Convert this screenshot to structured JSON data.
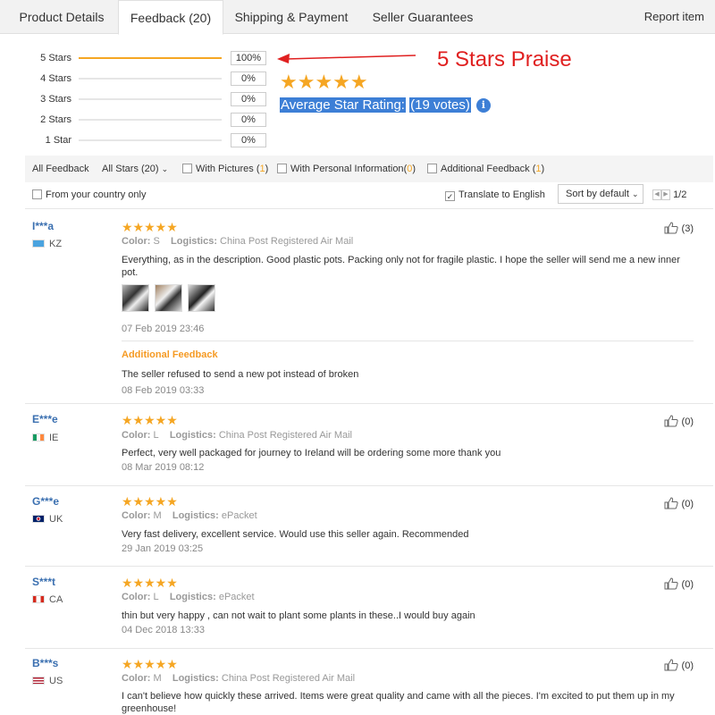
{
  "tabs": [
    {
      "label": "Product Details"
    },
    {
      "label": "Feedback (20)"
    },
    {
      "label": "Shipping & Payment"
    },
    {
      "label": "Seller Guarantees"
    }
  ],
  "report_label": "Report item",
  "rating_breakdown": [
    {
      "label": "5 Stars",
      "percent": "100%",
      "fill": 1.0
    },
    {
      "label": "4 Stars",
      "percent": "0%",
      "fill": 0
    },
    {
      "label": "3 Stars",
      "percent": "0%",
      "fill": 0
    },
    {
      "label": "2 Stars",
      "percent": "0%",
      "fill": 0
    },
    {
      "label": "1 Star",
      "percent": "0%",
      "fill": 0
    }
  ],
  "praise_label": "5 Stars Praise",
  "average": {
    "label": "Average Star Rating:",
    "votes": "(19 votes)",
    "stars": 5,
    "info_icon": "i"
  },
  "filters": {
    "all_feedback": "All Feedback",
    "all_stars": "All Stars (20)",
    "with_pictures": {
      "label": "With Pictures",
      "count": "1"
    },
    "with_personal": {
      "label": "With Personal Information",
      "count": "0"
    },
    "additional": {
      "label": "Additional Feedback",
      "count": "1"
    },
    "from_country": "From your country only",
    "translate": "Translate to English",
    "sort": "Sort by default",
    "page": "1/2"
  },
  "colors": {
    "accent": "#f5a623",
    "link": "#3a6fb0",
    "praise": "#e02020",
    "highlight": "#3d7fd6"
  },
  "reviews": [
    {
      "name": "I***a",
      "country": "KZ",
      "flag": "kz",
      "color_label": "Color:",
      "color": "S",
      "logistics_label": "Logistics:",
      "logistics": "China Post Registered Air Mail",
      "text": "Everything, as in the description. Good plastic pots. Packing only not for fragile plastic. I hope the seller will send me a new inner pot.",
      "date": "07 Feb 2019 23:46",
      "helpful": "(3)",
      "additional_label": "Additional Feedback",
      "additional_text": "The seller refused to send a new pot instead of broken",
      "additional_date": "08 Feb 2019 03:33"
    },
    {
      "name": "E***e",
      "country": "IE",
      "flag": "ie",
      "color_label": "Color:",
      "color": "L",
      "logistics_label": "Logistics:",
      "logistics": "China Post Registered Air Mail",
      "text": "Perfect, very well packaged for journey to Ireland will be ordering some more thank you",
      "date": "08 Mar 2019 08:12",
      "helpful": "(0)"
    },
    {
      "name": "G***e",
      "country": "UK",
      "flag": "uk",
      "color_label": "Color:",
      "color": "M",
      "logistics_label": "Logistics:",
      "logistics": "ePacket",
      "text": "Very fast delivery, excellent service. Would use this seller again. Recommended",
      "date": "29 Jan 2019 03:25",
      "helpful": "(0)"
    },
    {
      "name": "S***t",
      "country": "CA",
      "flag": "ca",
      "color_label": "Color:",
      "color": "L",
      "logistics_label": "Logistics:",
      "logistics": "ePacket",
      "text": "thin but very happy , can not wait to plant some plants in these..I would buy again",
      "date": "04 Dec 2018 13:33",
      "helpful": "(0)"
    },
    {
      "name": "B***s",
      "country": "US",
      "flag": "us",
      "color_label": "Color:",
      "color": "M",
      "logistics_label": "Logistics:",
      "logistics": "China Post Registered Air Mail",
      "text": "I can't believe how quickly these arrived. Items were great quality and came with all the pieces. I'm excited to put them up in my greenhouse!",
      "helpful": "(0)"
    }
  ]
}
